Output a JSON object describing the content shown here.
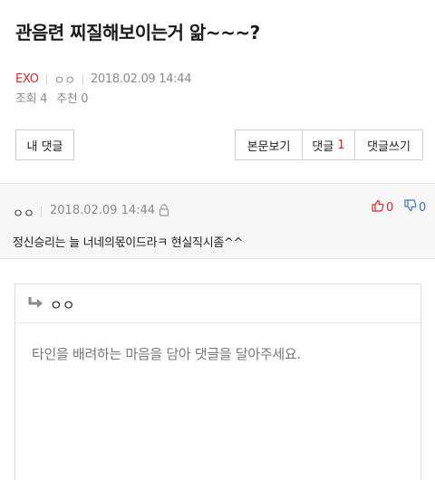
{
  "post": {
    "title": "관음련 찌질해보이는거 앎~~~?",
    "category": "EXO",
    "author": "ㅇㅇ",
    "datetime": "2018.02.09 14:44",
    "views": "조회 4",
    "recommends": "추천 0"
  },
  "buttons": {
    "my_comments": "내 댓글",
    "view_post": "본문보기",
    "comments_label": "댓글",
    "comments_count": "1",
    "write_comment": "댓글쓰기"
  },
  "comment": {
    "author": "ㅇㅇ",
    "datetime": "2018.02.09 14:44",
    "upvotes": "0",
    "downvotes": "0",
    "text": "정신승리는 늘 너네의몫이드라ㅋ 현실직시좀^^"
  },
  "write": {
    "user": "ㅇㅇ",
    "placeholder": "타인을 배려하는 마음을 담아 댓글을 달아주세요."
  },
  "colors": {
    "accent_red": "#d6282d",
    "down_blue": "#3a76b8"
  },
  "icons": [
    "lock-icon",
    "thumbs-up-icon",
    "thumbs-down-icon",
    "reply-arrow-icon"
  ]
}
